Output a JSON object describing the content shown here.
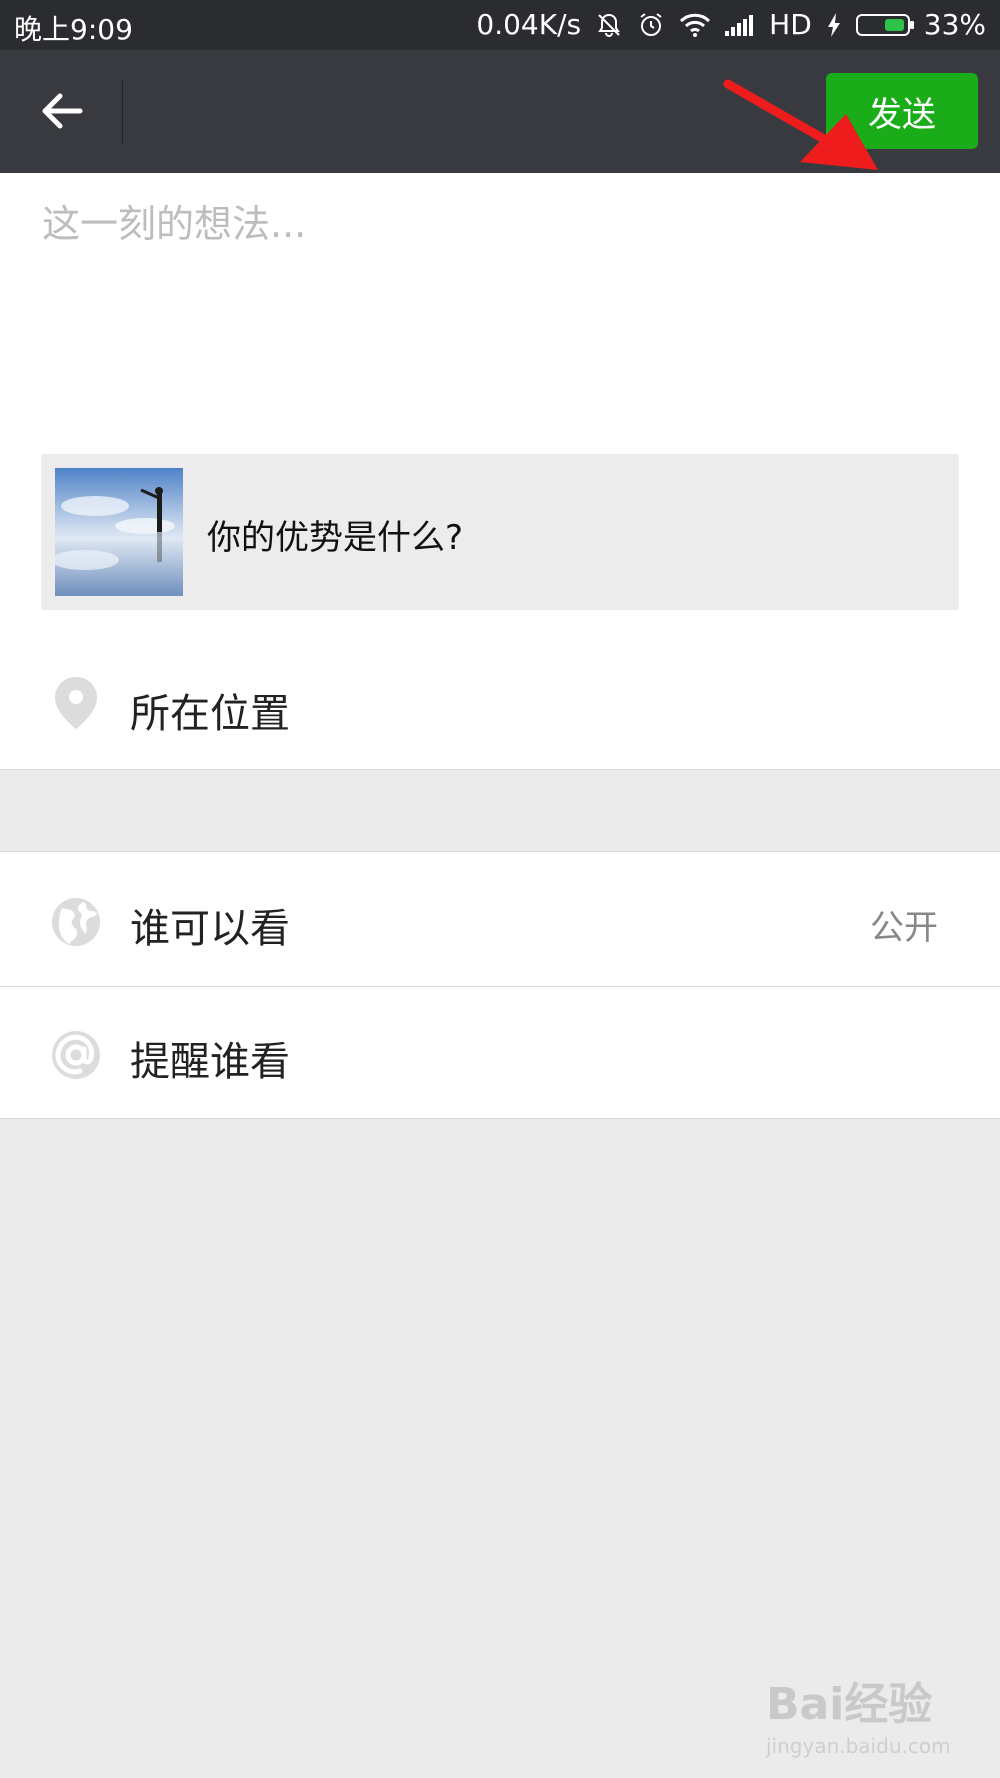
{
  "status_bar": {
    "time": "晚上9:09",
    "net_speed": "0.04K/s",
    "network_type": "HD",
    "battery": "33%",
    "battery_level": 0.33,
    "icons": [
      "mute-icon",
      "alarm-icon",
      "wifi-icon",
      "signal-icon",
      "charging-icon",
      "battery-icon"
    ]
  },
  "navbar": {
    "back_icon": "back-arrow-icon",
    "send_label": "发送",
    "send_color": "#1aad19",
    "bar_color": "#393a3f"
  },
  "compose": {
    "placeholder": "这一刻的想法...",
    "value": ""
  },
  "link_card": {
    "title": "你的优势是什么?"
  },
  "options": {
    "location": {
      "label": "所在位置",
      "icon": "location-pin-icon"
    },
    "visibility": {
      "label": "谁可以看",
      "value": "公开",
      "icon": "globe-icon"
    },
    "remind": {
      "label": "提醒谁看",
      "icon": "at-icon"
    }
  },
  "watermark": {
    "logo": "Bai经验",
    "url": "jingyan.baidu.com"
  }
}
